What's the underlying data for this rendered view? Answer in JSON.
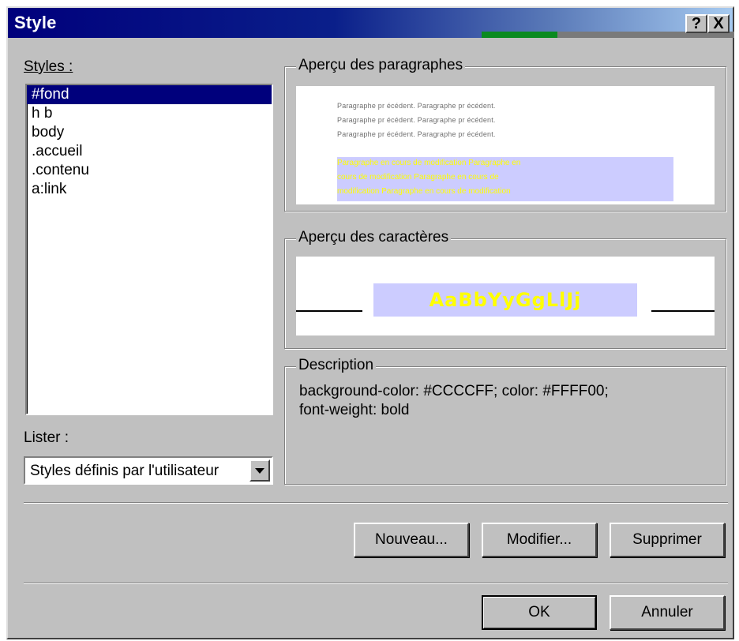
{
  "window": {
    "title": "Style",
    "help_label": "?",
    "close_label": "X"
  },
  "styles_panel": {
    "label": "Styles :",
    "items": [
      "#fond",
      "h b",
      "body",
      ".accueil",
      ".contenu",
      "a:link"
    ],
    "selected_index": 0
  },
  "list_panel": {
    "label": "Lister :",
    "selected_value": "Styles définis par l'utilisateur"
  },
  "paragraph_preview": {
    "title": "Aperçu des paragraphes",
    "previous_lines": [
      "Paragraphe pr    écédent. Paragraphe pr    écédent.",
      "Paragraphe pr    écédent. Paragraphe pr    écédent.",
      "Paragraphe pr    écédent. Paragraphe pr    écédent."
    ],
    "modified_lines": [
      "Paragraphe en cours de modification Paragraphe en",
      "cours de modification Paragraphe en cours de",
      "modification Paragraphe en cours de modification"
    ]
  },
  "character_preview": {
    "title": "Aperçu des caractères",
    "sample": "AaBbYyGgLlJj"
  },
  "description": {
    "title": "Description",
    "lines": [
      "background-color: #CCCCFF; color: #FFFF00;",
      "font-weight: bold"
    ]
  },
  "buttons": {
    "new": "Nouveau...",
    "modify": "Modifier...",
    "delete": "Supprimer",
    "ok": "OK",
    "cancel": "Annuler"
  },
  "colors": {
    "titlebar": "#00007C",
    "dialog_bg": "#C0C0C0",
    "selection": "#00007C",
    "preview_highlight": "#CCCCFF",
    "preview_text": "#FFFF00"
  }
}
